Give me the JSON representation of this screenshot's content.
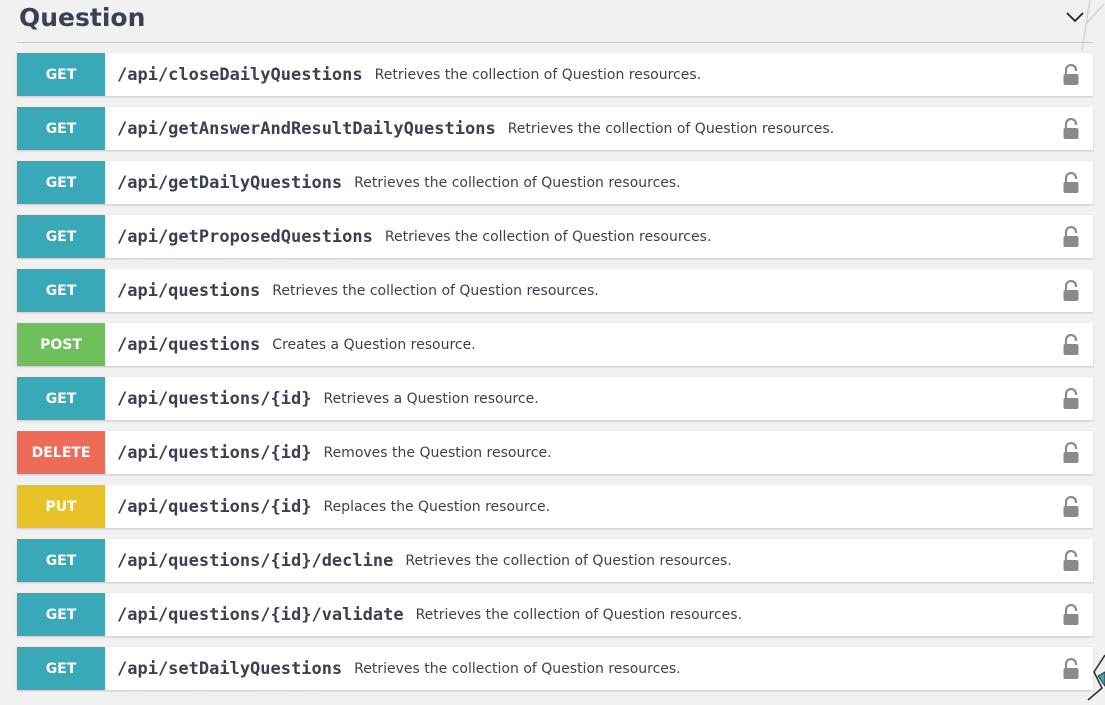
{
  "section": {
    "title": "Question"
  },
  "colors": {
    "GET": "#3aa9b7",
    "POST": "#6fbf5c",
    "DELETE": "#ee6b5a",
    "PUT": "#e8c229"
  },
  "operations": [
    {
      "method": "GET",
      "path": "/api/closeDailyQuestions",
      "description": "Retrieves the collection of Question resources."
    },
    {
      "method": "GET",
      "path": "/api/getAnswerAndResultDailyQuestions",
      "description": "Retrieves the collection of Question resources."
    },
    {
      "method": "GET",
      "path": "/api/getDailyQuestions",
      "description": "Retrieves the collection of Question resources."
    },
    {
      "method": "GET",
      "path": "/api/getProposedQuestions",
      "description": "Retrieves the collection of Question resources."
    },
    {
      "method": "GET",
      "path": "/api/questions",
      "description": "Retrieves the collection of Question resources."
    },
    {
      "method": "POST",
      "path": "/api/questions",
      "description": "Creates a Question resource."
    },
    {
      "method": "GET",
      "path": "/api/questions/{id}",
      "description": "Retrieves a Question resource."
    },
    {
      "method": "DELETE",
      "path": "/api/questions/{id}",
      "description": "Removes the Question resource."
    },
    {
      "method": "PUT",
      "path": "/api/questions/{id}",
      "description": "Replaces the Question resource."
    },
    {
      "method": "GET",
      "path": "/api/questions/{id}/decline",
      "description": "Retrieves the collection of Question resources."
    },
    {
      "method": "GET",
      "path": "/api/questions/{id}/validate",
      "description": "Retrieves the collection of Question resources."
    },
    {
      "method": "GET",
      "path": "/api/setDailyQuestions",
      "description": "Retrieves the collection of Question resources."
    }
  ]
}
